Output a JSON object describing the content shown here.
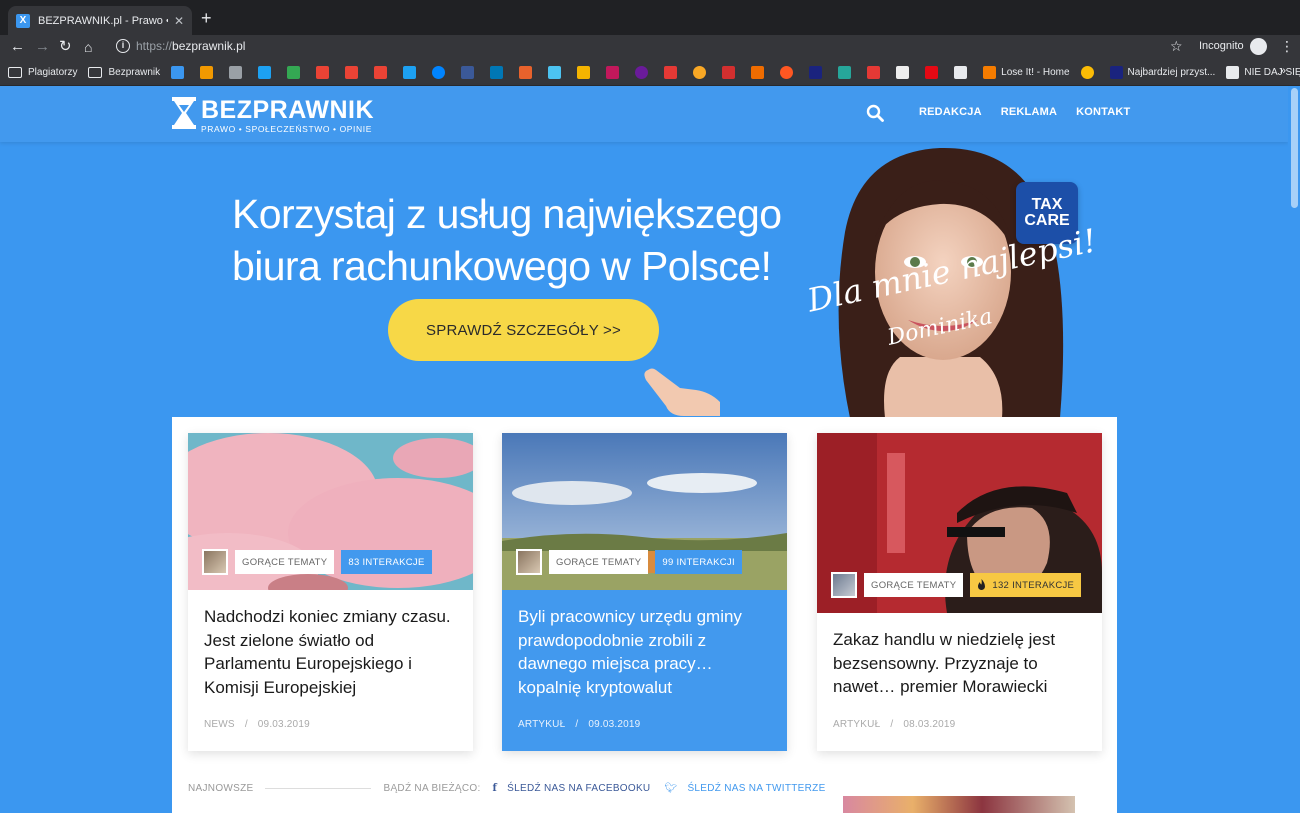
{
  "browser": {
    "tab_title": "BEZPRAWNIK.pl - Prawo • Spo",
    "favicon_letter": "X",
    "url_scheme": "https://",
    "url_host": "bezprawnik.pl",
    "incognito_label": "Incognito",
    "bookmarks": [
      {
        "label": "Plagiatorzy",
        "type": "folder"
      },
      {
        "label": "Bezprawnik",
        "type": "folder"
      },
      {
        "label": "Lose It! - Home",
        "type": "site"
      },
      {
        "label": "Najbardziej przyst...",
        "type": "site"
      },
      {
        "label": "NIE DAJ SIĘ STRZ...",
        "type": "site"
      }
    ],
    "bookmark_more": "»"
  },
  "site": {
    "logo_name": "BEZPRAWNIK",
    "logo_tagline": "PRAWO  •  SPOŁECZEŃSTWO  •  OPINIE",
    "nav": [
      "REDAKCJA",
      "REKLAMA",
      "KONTAKT"
    ]
  },
  "ad": {
    "headline_line1": "Korzystaj z usług największego",
    "headline_line2": "biura rachunkowego w Polsce!",
    "cta": "SPRAWDŹ SZCZEGÓŁY  >>",
    "badge_line1": "TAX",
    "badge_line2": "CARE",
    "script_line1": "Dla mnie najlepsi!",
    "script_line2": "Dominika"
  },
  "cards": [
    {
      "tag": "GORĄCE TEMATY",
      "interactions": "83 INTERAKCJE",
      "title": "Nadchodzi koniec zmiany czasu. Jest zielone światło od Parlamentu Europejskiego i Komisji Europejskiej",
      "category": "NEWS",
      "date": "09.03.2019"
    },
    {
      "tag": "GORĄCE TEMATY",
      "interactions": "99 INTERAKCJI",
      "title": "Byli pracownicy urzędu gminy prawdopodobnie zrobili z dawnego miejsca pracy… kopalnię kryptowalut",
      "category": "ARTYKUŁ",
      "date": "09.03.2019"
    },
    {
      "tag": "GORĄCE TEMATY",
      "interactions": "132 INTERAKCJE",
      "title": "Zakaz handlu w niedzielę jest bezsensowny. Przyznaje to nawet… premier Morawiecki",
      "category": "ARTYKUŁ",
      "date": "08.03.2019"
    }
  ],
  "news_bar": {
    "latest": "NAJNOWSZE",
    "stay": "BĄDŹ NA BIEŻĄCO:",
    "facebook": "ŚLEDŹ NAS NA FACEBOOKU",
    "twitter": "ŚLEDŹ NAS NA TWITTERZE"
  },
  "colors": {
    "brand_blue": "#3b97f0",
    "cta_yellow": "#f7d847",
    "hot_chip": "#f7c843",
    "taxcare_navy": "#1c4fa8"
  }
}
